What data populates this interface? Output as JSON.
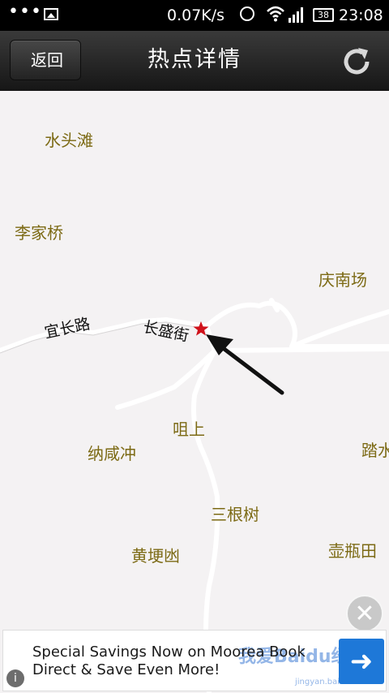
{
  "status_bar": {
    "dots": "•••",
    "network_speed": "0.07K/s",
    "battery": "38",
    "time": "23:08"
  },
  "header": {
    "back_label": "返回",
    "title": "热点详情"
  },
  "map": {
    "places": [
      "水头滩",
      "李家桥",
      "庆南场",
      "咀上",
      "纳咸冲",
      "踏水",
      "三根树",
      "黄埂凼",
      "壶瓶田"
    ],
    "roads": [
      "宜长路",
      "长盛街"
    ]
  },
  "ad": {
    "line1": "Special Savings Now on Moorea Book",
    "line2": "Direct & Save Even More!",
    "watermark": "我爱Baidu经验",
    "watermark_url": "jingyan.baidu.com"
  },
  "colors": {
    "header_bg": "#1f1f1f",
    "place_label": "#7c6a14",
    "marker": "#d0121b",
    "ad_button": "#1e78d8"
  },
  "icons": [
    "image-icon",
    "alarm-icon",
    "wifi-icon",
    "signal-icon",
    "battery-icon",
    "refresh-icon",
    "star-marker-icon",
    "arrow-icon",
    "close-icon",
    "info-icon"
  ]
}
